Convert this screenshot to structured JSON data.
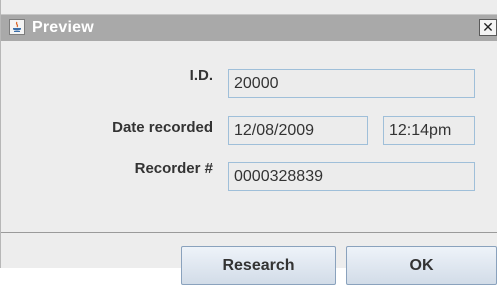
{
  "window": {
    "title": "Preview",
    "close_symbol": "✕",
    "icon": "java-icon"
  },
  "form": {
    "id_label": "I.D.",
    "id_value": "20000",
    "date_label": "Date recorded",
    "date_value": "12/08/2009",
    "time_value": "12:14pm",
    "recorder_label": "Recorder #",
    "recorder_value": "0000328839"
  },
  "buttons": {
    "research_label": "Research",
    "ok_label": "OK"
  },
  "colors": {
    "titlebar": "#a9a9a9",
    "field_border": "#9fbfd9",
    "button_border": "#8aa2bd"
  }
}
